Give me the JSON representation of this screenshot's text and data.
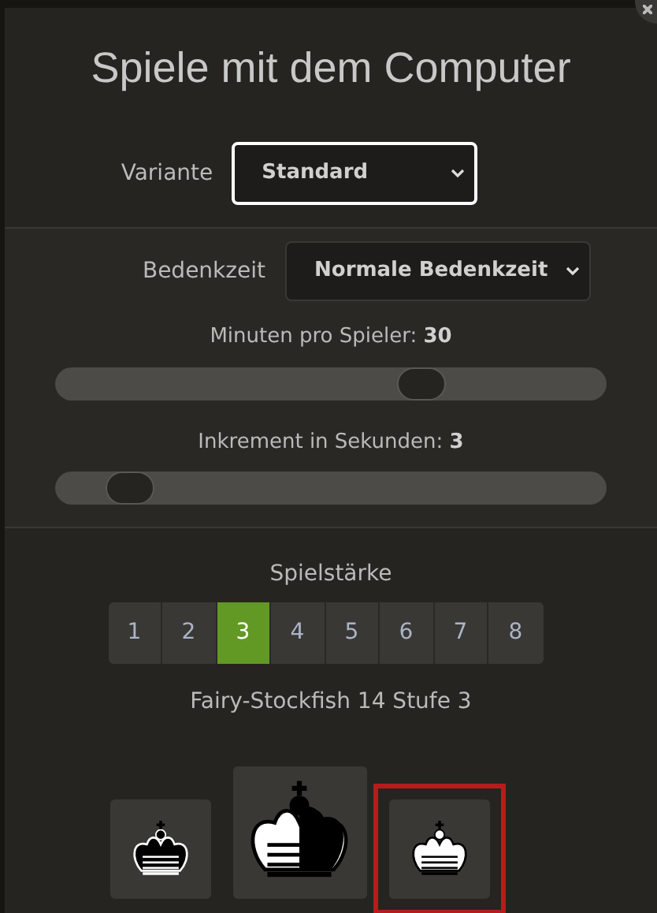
{
  "title": "Spiele mit dem Computer",
  "variant": {
    "label": "Variante",
    "value": "Standard",
    "focused": true
  },
  "time_control": {
    "label": "Bedenkzeit",
    "value": "Normale Bedenkzeit"
  },
  "sliders": [
    {
      "label": "Minuten pro Spieler: ",
      "value": "30",
      "level": 0.68
    },
    {
      "label": "Inkrement in Sekunden: ",
      "value": "3",
      "level": 0.1
    }
  ],
  "strength": {
    "label": "Spielstärke",
    "levels": [
      {
        "label": "1",
        "selected": false
      },
      {
        "label": "2",
        "selected": false
      },
      {
        "label": "3",
        "selected": true
      },
      {
        "label": "4",
        "selected": false
      },
      {
        "label": "5",
        "selected": false
      },
      {
        "label": "6",
        "selected": false
      },
      {
        "label": "7",
        "selected": false
      },
      {
        "label": "8",
        "selected": false
      }
    ]
  },
  "engine": "Fairy-Stockfish 14 Stufe 3",
  "colors": [
    {
      "kind": "black",
      "selected": false
    },
    {
      "kind": "random",
      "selected": false
    },
    {
      "kind": "white",
      "selected": true
    }
  ]
}
